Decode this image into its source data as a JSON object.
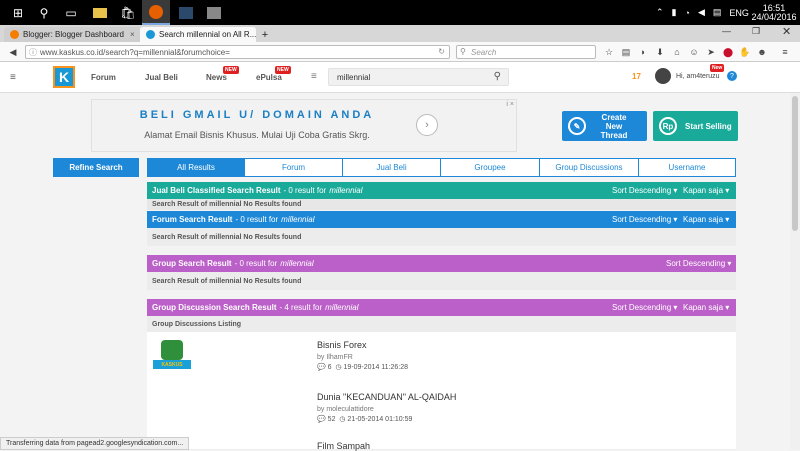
{
  "taskbar": {
    "time": "16:51",
    "date": "24/04/2016",
    "lang": "ENG"
  },
  "browser": {
    "tabs": [
      {
        "label": "Blogger: Blogger Dashboard"
      },
      {
        "label": "Search millennial on All R..."
      }
    ],
    "url": "www.kaskus.co.id/search?q=millennial&forumchoice=",
    "search_placeholder": "Search"
  },
  "header": {
    "nav": [
      {
        "label": "Forum"
      },
      {
        "label": "Jual Beli"
      },
      {
        "label": "News",
        "badge": "NEW"
      },
      {
        "label": "ePulsa",
        "badge": "NEW"
      }
    ],
    "search_value": "millennial",
    "notif_count": "17",
    "user_greeting": "Hi, am4teruzu",
    "user_badge": "New"
  },
  "ad": {
    "headline": "BELI GMAIL U/ DOMAIN ANDA",
    "subline": "Alamat Email Bisnis Khusus. Mulai Uji Coba Gratis Skrg.",
    "close": "i ×"
  },
  "actions": {
    "create_thread": "Create New Thread",
    "start_selling": "Start Selling"
  },
  "filters": {
    "refine": "Refine Search",
    "tabs": [
      "All Results",
      "Forum",
      "Jual Beli",
      "Groupee",
      "Group Discussions",
      "Username"
    ]
  },
  "sections": {
    "jualbeli": {
      "title": "Jual Beli Classified Search Result",
      "count": "- 0 result for",
      "query": "millennial",
      "sort": "Sort Descending",
      "time": "Kapan saja",
      "sub": "Search Result of millennial No Results found"
    },
    "forum": {
      "title": "Forum Search Result",
      "count": "- 0 result for",
      "query": "millennial",
      "sort": "Sort Descending",
      "time": "Kapan saja",
      "sub": "Search Result of millennial No Results found"
    },
    "group": {
      "title": "Group Search Result",
      "count": "- 0 result for",
      "query": "millennial",
      "sort": "Sort Descending",
      "sub": "Search Result of millennial No Results found"
    },
    "discussion": {
      "title": "Group Discussion Search Result",
      "count": "- 4 result for",
      "query": "millennial",
      "sort": "Sort Descending",
      "time": "Kapan saja",
      "sub": "Group Discussions Listing"
    }
  },
  "discussions": [
    {
      "title": "Bisnis Forex",
      "user": "by IlhamFR",
      "replies": "6",
      "date": "19-09-2014 11:26:28",
      "logo_text": "KASKUS"
    },
    {
      "title": "Dunia \"KECANDUAN\" AL-QAIDAH",
      "user": "by moleculattidore",
      "replies": "52",
      "date": "21-05-2014 01:10:59"
    },
    {
      "title": "Film Sampah"
    }
  ],
  "status_text": "Transferring data from pagead2.googlesyndication.com...",
  "colors": {
    "teal": "#1aaa9a",
    "blue": "#1e88d8",
    "purple": "#bb60c8"
  }
}
